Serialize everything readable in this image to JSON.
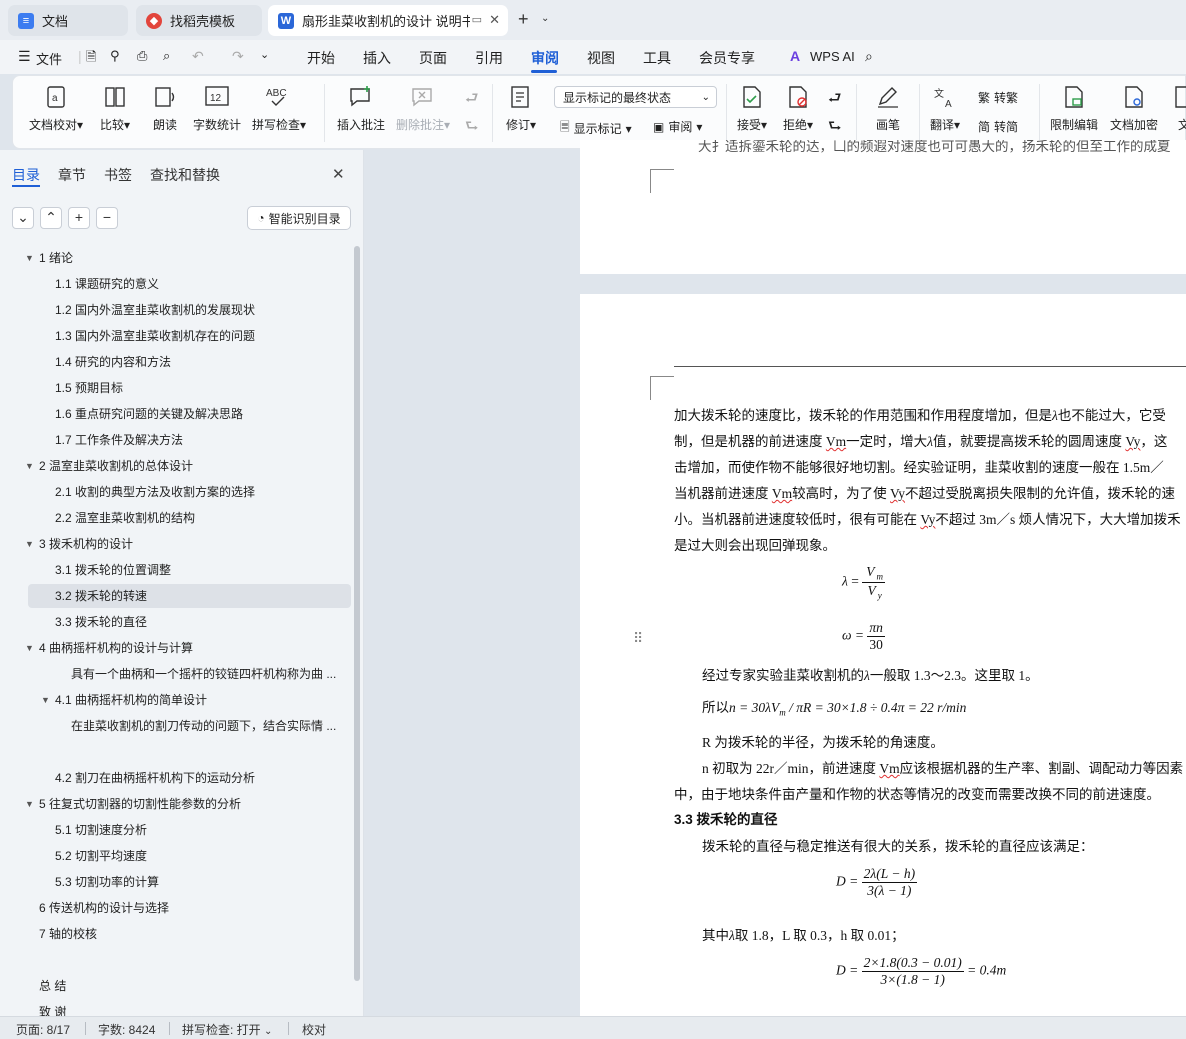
{
  "tabs": [
    {
      "label": "文档",
      "icon": "doc-icon",
      "color": "#3c7cf0"
    },
    {
      "label": "找稻壳模板",
      "icon": "docer-icon",
      "color": "#e2453c"
    },
    {
      "label": "扇形韭菜收割机的设计 说明书"
    }
  ],
  "menu": {
    "file": "文件",
    "items": [
      "开始",
      "插入",
      "页面",
      "引用",
      "审阅",
      "视图",
      "工具",
      "会员专享"
    ],
    "active": "审阅",
    "ai": "WPS AI"
  },
  "ribbon": {
    "doc_check": "文档校对",
    "compare": "比较",
    "read_aloud": "朗读",
    "word_count": "字数统计",
    "word_count_icon": "12",
    "spell_check": "拼写检查",
    "spell_icon": "ABC",
    "insert_comment": "插入批注",
    "delete_comment": "删除批注",
    "revise": "修订",
    "show_markup_final": "显示标记的最终状态",
    "show_markup": "显示标记",
    "review": "审阅",
    "accept": "接受",
    "reject": "拒绝",
    "pen": "画笔",
    "translate": "翻译",
    "trad": "转繁",
    "simp": "转简",
    "restrict_edit": "限制编辑",
    "encrypt": "文档加密",
    "doc_more": "文"
  },
  "panel": {
    "tabs": [
      "目录",
      "章节",
      "书签",
      "查找和替换"
    ],
    "smart_toc": "智能识别目录",
    "toc": [
      {
        "t": "1 绪论",
        "lvl": 1,
        "exp": true
      },
      {
        "t": "1.1 课题研究的意义",
        "lvl": 2
      },
      {
        "t": "1.2 国内外温室韭菜收割机的发展现状",
        "lvl": 2
      },
      {
        "t": "1.3 国内外温室韭菜收割机存在的问题",
        "lvl": 2
      },
      {
        "t": "1.4 研究的内容和方法",
        "lvl": 2
      },
      {
        "t": "1.5 预期目标",
        "lvl": 2
      },
      {
        "t": "1.6 重点研究问题的关键及解决思路",
        "lvl": 2
      },
      {
        "t": "1.7 工作条件及解决方法",
        "lvl": 2
      },
      {
        "t": "2 温室韭菜收割机的总体设计",
        "lvl": 1,
        "exp": true
      },
      {
        "t": "2.1 收割的典型方法及收割方案的选择",
        "lvl": 2
      },
      {
        "t": "2.2 温室韭菜收割机的结构",
        "lvl": 2
      },
      {
        "t": "3 拨禾机构的设计",
        "lvl": 1,
        "exp": true
      },
      {
        "t": "3.1 拨禾轮的位置调整",
        "lvl": 2
      },
      {
        "t": "3.2 拨禾轮的转速",
        "lvl": 2,
        "sel": true
      },
      {
        "t": "3.3  拨禾轮的直径",
        "lvl": 2
      },
      {
        "t": "4 曲柄摇杆机构的设计与计算",
        "lvl": 1,
        "exp": true
      },
      {
        "t": "具有一个曲柄和一个摇杆的铰链四杆机构称为曲 ...",
        "lvl": 3
      },
      {
        "t": "4.1 曲柄摇杆机构的简单设计",
        "lvl": 2,
        "exp": true
      },
      {
        "t": "在韭菜收割机的割刀传动的问题下，结合实际情 ...",
        "lvl": 3
      },
      {
        "t": "",
        "lvl": 3
      },
      {
        "t": "4.2 割刀在曲柄摇杆机构下的运动分析",
        "lvl": 2
      },
      {
        "t": "5 往复式切割器的切割性能参数的分析",
        "lvl": 1,
        "exp": true
      },
      {
        "t": "5.1 切割速度分析",
        "lvl": 2
      },
      {
        "t": "5.2 切割平均速度",
        "lvl": 2
      },
      {
        "t": "5.3 切割功率的计算",
        "lvl": 2
      },
      {
        "t": "6 传送机构的设计与选择",
        "lvl": 1
      },
      {
        "t": "7  轴的校核",
        "lvl": 1
      },
      {
        "t": "",
        "lvl": 1
      },
      {
        "t": "总  结",
        "lvl": 1
      },
      {
        "t": "致  谢",
        "lvl": 1
      }
    ]
  },
  "doc": {
    "top_partial": "大扌适拆鎏禾轮的达，凵的频遐对速度也可可愚大的，扬禾轮的但至工作的成夏",
    "p1": "加大拨禾轮的速度比，拨禾轮的作用范围和作用程度增加，但是",
    "p1b": "也不能过大，它受",
    "p2a": "制，但是机器的前进速度 ",
    "vm": "Vm",
    "p2b": "一定时，增大",
    "p2c": "值，就要提高拨禾轮的圆周速度 ",
    "vy": "Vy",
    "p2d": "，这",
    "p3": "击增加，而使作物不能够很好地切割。经实验证明，韭菜收割的速度一般在 1.5m／",
    "p4a": "当机器前进速度 ",
    "p4b": "较高时，为了使 ",
    "p4c": "不超过受脱离损失限制的允许值，拨禾轮的速",
    "p5a": "小。当机器前进速度较低时，很有可能在 ",
    "p5b": "不超过 3m／s 烦人情况下，大大增加拨禾",
    "p6": "是过大则会出现回弹现象。",
    "lambda": "λ",
    "eq1_num": "V",
    "eq1_num_sub": "m",
    "eq1_den": "V",
    "eq1_den_sub": "y",
    "eq2_lhs": "ω =",
    "eq2_num": "πn",
    "eq2_den": "30",
    "p7a": "经过专家实验韭菜收割机的",
    "p7b": "一般取 1.3～2.3。这里取 1。",
    "p8a": "所以",
    "p8b": "n = 30λV",
    "p8c": "m",
    "p8d": " / πR = 30×1.8 ÷ 0.4π = 22 r/min",
    "p9": "R 为拨禾轮的半径，为拨禾轮的角速度。",
    "p10a": "n 初取为 22r／min，前进速度 ",
    "p10b": "应该根据机器的生产率、割副、调配动力等因素",
    "p11": "中，由于地块条件亩产量和作物的状态等情况的改变而需要改换不同的前进速度。",
    "h33": "3.3  拨禾轮的直径",
    "p12": "拨禾轮的直径与稳定推送有很大的关系，拨禾轮的直径应该满足：",
    "eq3_lhs": "D =",
    "eq3_num": "2λ(L − h)",
    "eq3_den": "3(λ − 1)",
    "p13a": "其中",
    "p13b": "取 1.8，L 取 0.3，h 取 0.01；",
    "eq4_lhs": "D =",
    "eq4_num": "2×1.8(0.3 − 0.01)",
    "eq4_den": "3×(1.8 − 1)",
    "eq4_rhs": "= 0.4m"
  },
  "status": {
    "page": "页面: 8/17",
    "words": "字数: 8424",
    "spell": "拼写检查: 打开",
    "proof": "校对"
  }
}
